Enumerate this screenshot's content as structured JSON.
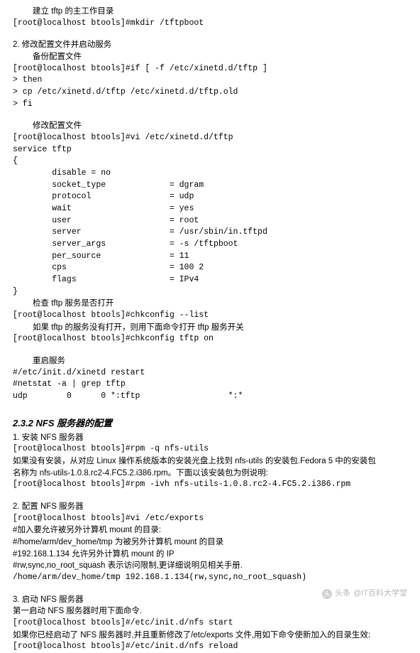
{
  "s1": {
    "t1": "建立 tftp 的主工作目录",
    "cmd1": "[root@localhost btools]#mkdir /tftpboot",
    "step2": "2. 修改配置文件并启动服务",
    "t2": "备份配置文件",
    "cmd2a": "[root@localhost btools]#if [ -f /etc/xinetd.d/tftp ]",
    "cmd2b": "> then",
    "cmd2c": "> cp /etc/xinetd.d/tftp /etc/xinetd.d/tftp.old",
    "cmd2d": "> fi",
    "t3": "修改配置文件",
    "cmd3": "[root@localhost btools]#vi /etc/xinetd.d/tftp",
    "svc": "service tftp",
    "ob": "{",
    "l1": "        disable = no",
    "l2": "        socket_type             = dgram",
    "l3": "        protocol                = udp",
    "l4": "        wait                    = yes",
    "l5": "        user                    = root",
    "l6": "        server                  = /usr/sbin/in.tftpd",
    "l7": "        server_args             = -s /tftpboot",
    "l8": "        per_source              = 11",
    "l9": "        cps                     = 100 2",
    "l10": "        flags                   = IPv4",
    "cb": "}",
    "t4": "检查 tftp 服务是否打开",
    "cmd4": "[root@localhost btools]#chkconfig --list",
    "t5a": "如果 tftp 的服务没有打开，则用下面命令打开 tftp 服务开关",
    "cmd5": "[root@localhost btools]#chkconfig tftp on",
    "t6": "重启服务",
    "cmd6a": "#/etc/init.d/xinetd restart",
    "cmd6b": "#netstat -a | grep tftp",
    "cmd6c": "udp        0      0 *:tftp                  *:*"
  },
  "s2": {
    "heading": "2.3.2 NFS 服务器的配置",
    "step1": "1. 安装 NFS 服务器",
    "cmd1": "[root@localhost btools]#rpm -q nfs-utils",
    "p1a": "如果没有安装，从对应 Linux 操作系统版本的安装光盘上找到 nfs-utils 的安装包.Fedora 5 中的安装包",
    "p1b": "名称为 nfs-utils-1.0.8.rc2-4.FC5.2.i386.rpm。下面以该安装包为例说明:",
    "cmd2": "[root@localhost btools]#rpm -ivh nfs-utils-1.0.8.rc2-4.FC5.2.i386.rpm",
    "step2": "2. 配置 NFS 服务器",
    "cmd3": "[root@localhost btools]#vi /etc/exports",
    "p2": "#加入要允许被另外计算机 mount 的目录:",
    "p3": "#/home/arm/dev_home/tmp 为被另外计算机 mount 的目录",
    "p4": "#192.168.1.134 允许另外计算机 mount 的 IP",
    "p5": "#rw,sync,no_root_squash 表示访问限制,更详细说明见相关手册.",
    "cmd4": "/home/arm/dev_home/tmp 192.168.1.134(rw,sync,no_root_squash)",
    "step3": "3. 启动 NFS 服务器",
    "p6": "第一启动 NFS 服务器时用下面命令.",
    "cmd5": "[root@localhost btools]#/etc/init.d/nfs start",
    "p7": "如果你已经启动了 NFS 服务器时,并且重新修改了/etc/exports 文件,用如下命令使新加入的目录生效:",
    "cmd6": "[root@localhost btools]#/etc/init.d/nfs reload"
  },
  "wm": {
    "prefix": "头条",
    "text": "@IT百科大学堂"
  }
}
